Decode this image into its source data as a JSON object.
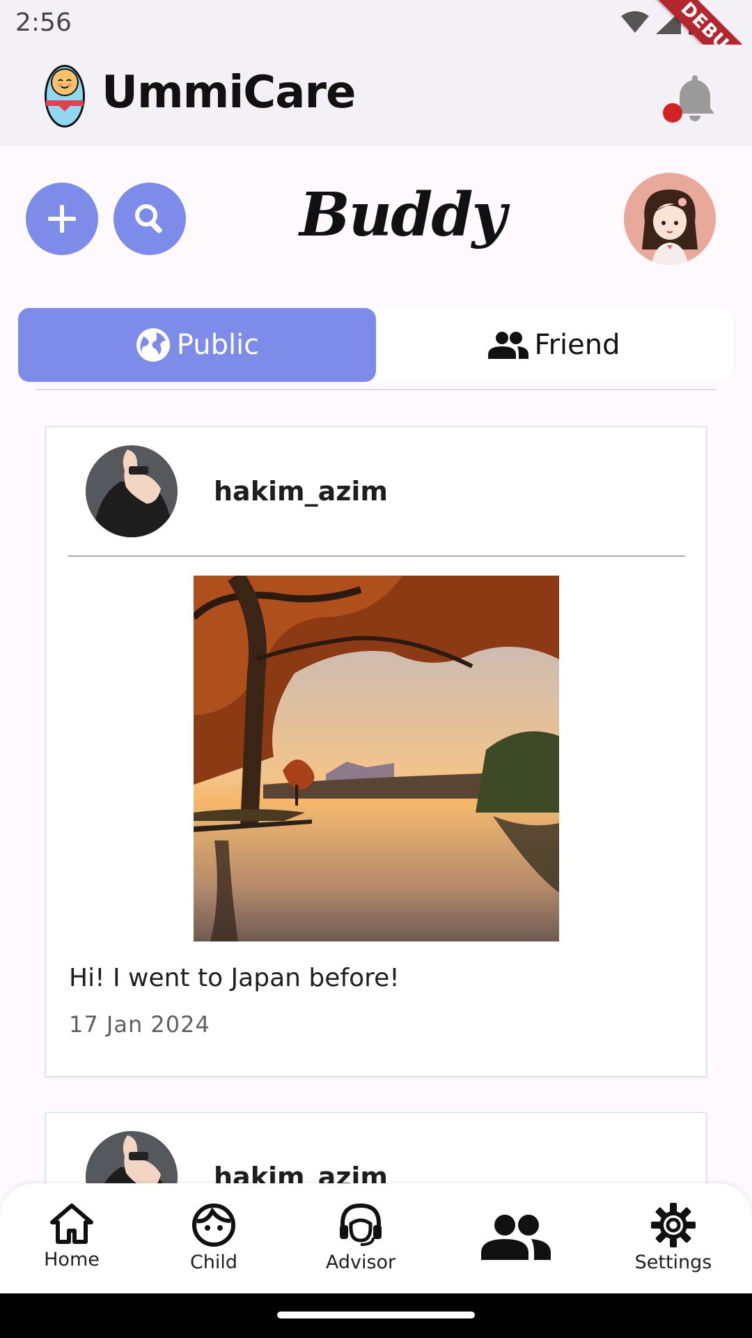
{
  "status_bar": {
    "time": "2:56",
    "debug_label": "DEBUG"
  },
  "app_bar": {
    "title": "UmmiCare"
  },
  "buddy": {
    "title": "Buddy",
    "tabs": [
      {
        "label": "Public",
        "icon": "globe-icon",
        "selected": true
      },
      {
        "label": "Friend",
        "icon": "people-icon",
        "selected": false
      }
    ]
  },
  "posts": [
    {
      "username": "hakim_azim",
      "caption": "Hi! I went to Japan before!",
      "date": "17 Jan 2024"
    },
    {
      "username": "hakim_azim"
    }
  ],
  "nav": [
    {
      "label": "Home",
      "icon": "home-icon"
    },
    {
      "label": "Child",
      "icon": "child-face-icon"
    },
    {
      "label": "Advisor",
      "icon": "headset-icon"
    },
    {
      "label": "",
      "icon": "people-icon",
      "selected": true
    },
    {
      "label": "Settings",
      "icon": "gear-icon"
    }
  ],
  "colors": {
    "accent": "#7d8ce9",
    "notification_dot": "#d32222",
    "app_bar_bg": "#f3f1f6"
  }
}
